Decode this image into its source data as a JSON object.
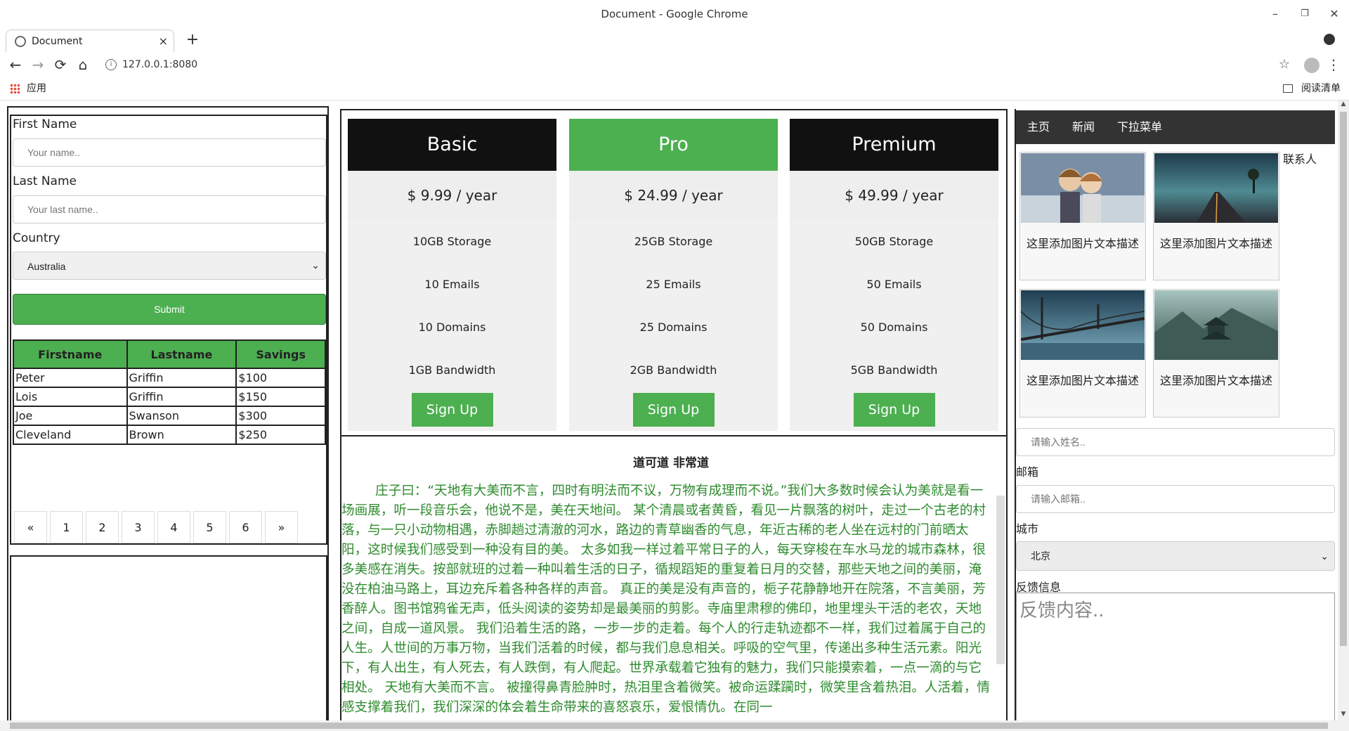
{
  "window": {
    "title": "Document - Google Chrome",
    "minimize_icon": "minimize-icon",
    "restore_icon": "restore-icon",
    "close_icon": "close-icon"
  },
  "tab": {
    "label": "Document",
    "close": "×",
    "new": "+"
  },
  "toolbar": {
    "back": "←",
    "forward": "→",
    "reload": "⟳",
    "home": "⌂",
    "url": "127.0.0.1:8080",
    "star": "☆",
    "menu": "⋮"
  },
  "bookmarks": {
    "apps": "应用",
    "reading_list": "阅读清单"
  },
  "left_form": {
    "first_name_label": "First Name",
    "first_name_placeholder": "Your name..",
    "last_name_label": "Last Name",
    "last_name_placeholder": "Your last name..",
    "country_label": "Country",
    "country_value": "Australia",
    "submit": "Submit"
  },
  "savings_table": {
    "headers": [
      "Firstname",
      "Lastname",
      "Savings"
    ],
    "rows": [
      [
        "Peter",
        "Griffin",
        "$100"
      ],
      [
        "Lois",
        "Griffin",
        "$150"
      ],
      [
        "Joe",
        "Swanson",
        "$300"
      ],
      [
        "Cleveland",
        "Brown",
        "$250"
      ]
    ]
  },
  "pagination": [
    "«",
    "1",
    "2",
    "3",
    "4",
    "5",
    "6",
    "»"
  ],
  "plans": [
    {
      "name": "Basic",
      "price": "$ 9.99 / year",
      "features": [
        "10GB Storage",
        "10 Emails",
        "10 Domains",
        "1GB Bandwidth"
      ],
      "cta": "Sign Up"
    },
    {
      "name": "Pro",
      "price": "$ 24.99 / year",
      "features": [
        "25GB Storage",
        "25 Emails",
        "25 Domains",
        "2GB Bandwidth"
      ],
      "cta": "Sign Up"
    },
    {
      "name": "Premium",
      "price": "$ 49.99 / year",
      "features": [
        "50GB Storage",
        "50 Emails",
        "50 Domains",
        "5GB Bandwidth"
      ],
      "cta": "Sign Up"
    }
  ],
  "article": {
    "title": "道可道 非常道",
    "body": "庄子曰：“天地有大美而不言，四时有明法而不议，万物有成理而不说。”我们大多数时候会认为美就是看一场画展，听一段音乐会，他说不是，美在天地间。 某个清晨或者黄昏，看见一片飘落的树叶，走过一个古老的村落，与一只小动物相遇，赤脚趟过清澈的河水，路边的青草幽香的气息，年近古稀的老人坐在远村的门前晒太阳，这时候我们感受到一种没有目的美。 太多如我一样过着平常日子的人，每天穿梭在车水马龙的城市森林，很多美感在消失。按部就班的过着一种叫着生活的日子，循规蹈矩的重复着日月的交替，那些天地之间的美丽，淹没在柏油马路上，耳边充斥着各种各样的声音。 真正的美是没有声音的，栀子花静静地开在院落，不言美丽，芳香醉人。图书馆鸦雀无声，低头阅读的姿势却是最美丽的剪影。寺庙里肃穆的佛印，地里埋头干活的老农，天地之间，自成一道风景。 我们沿着生活的路，一步一步的走着。每个人的行走轨迹都不一样，我们过着属于自己的人生。人世间的万事万物，当我们活着的时候，都与我们息息相关。呼吸的空气里，传递出多种生活元素。阳光下，有人出生，有人死去，有人跌倒，有人爬起。世界承载着它独有的魅力，我们只能摸索着，一点一滴的与它相处。 天地有大美而不言。 被撞得鼻青脸肿时，热泪里含着微笑。被命运蹂躏时，微笑里含着热泪。人活着，情感支撑着我们，我们深深的体会着生命带来的喜怒哀乐，爱恨情仇。在同一"
  },
  "right": {
    "nav": [
      "主页",
      "新闻",
      "下拉菜单"
    ],
    "gallery": [
      {
        "desc": "这里添加图片文本描述",
        "image": "anime-couple-snow"
      },
      {
        "desc": "这里添加图片文本描述",
        "image": "road-tree-sunset"
      },
      {
        "desc": "这里添加图片文本描述",
        "image": "bridge-sky"
      },
      {
        "desc": "这里添加图片文本描述",
        "image": "temple-mountain"
      }
    ],
    "contact": "联系人",
    "name_placeholder": "请输入姓名..",
    "email_label": "邮箱",
    "email_placeholder": "请输入邮箱..",
    "city_label": "城市",
    "city_value": "北京",
    "feedback_label": "反馈信息",
    "feedback_placeholder": "反馈内容.."
  },
  "colors": {
    "accent": "#4caf50",
    "dark": "#111111",
    "nav": "#333333",
    "article_text": "#2e8b2e"
  }
}
